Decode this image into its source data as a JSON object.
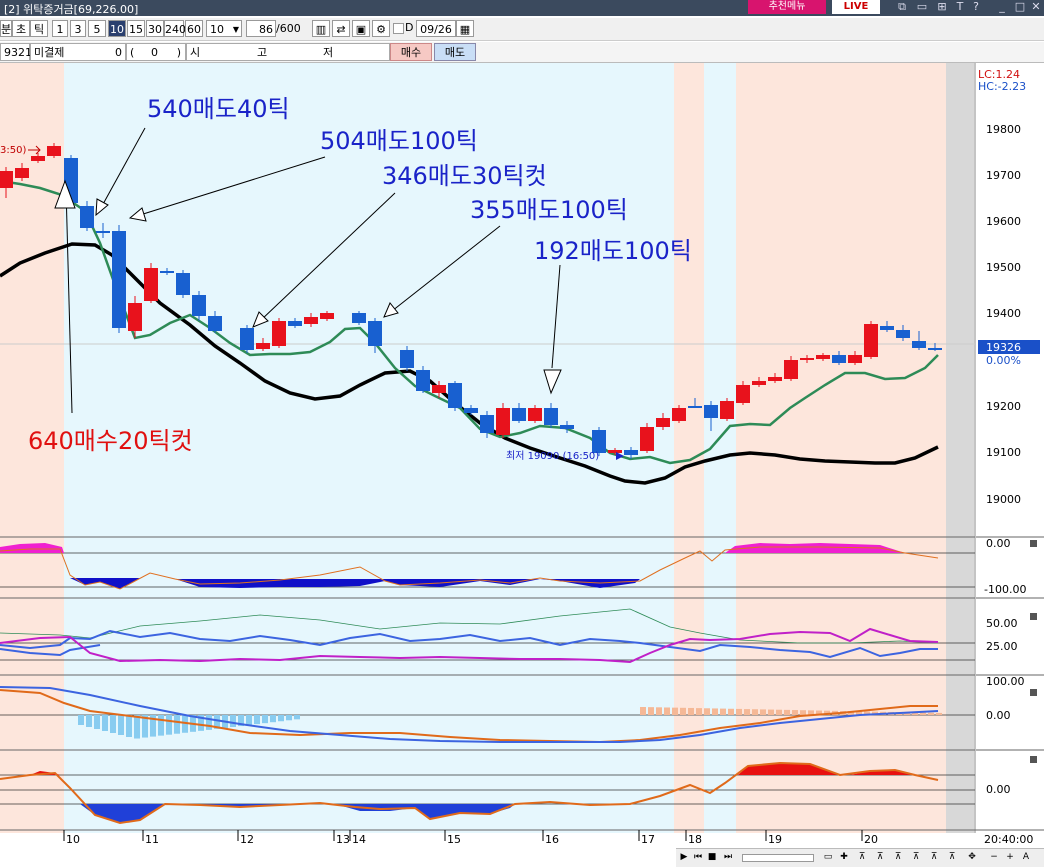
{
  "window": {
    "title": "[2] 위탁증거금[69,226.00]",
    "recommend_menu": "추천메뉴",
    "live": "LIVE"
  },
  "toolbar": {
    "buttons": [
      "분",
      "초",
      "틱",
      "1",
      "3",
      "5",
      "10",
      "15",
      "30",
      "240",
      "60"
    ],
    "selected": "10",
    "period_value": "10",
    "count_value": "86",
    "count_total": "/600",
    "date_value": "09/26",
    "d_label": "D"
  },
  "row2": {
    "code": "9321",
    "unsettled_label": "미결제",
    "unsettled_value": "0",
    "paren_left": "(",
    "paren_value": "0",
    "paren_right": ")",
    "open_label": "시",
    "high_label": "고",
    "low_label": "저",
    "buy_button": "매수",
    "sell_button": "매도"
  },
  "chart": {
    "lc_label": "LC:1.24",
    "hc_label": "HC:-2.23",
    "price_ticks": [
      "19800",
      "19700",
      "19600",
      "19500",
      "19400",
      "19300",
      "19200",
      "19100",
      "19000"
    ],
    "current_price": "19326",
    "current_change": "0.00%",
    "cut_label": "3:50)",
    "low_label": "최저 19090 (16:50)",
    "annotations": [
      {
        "text": "540매도40틱",
        "color": "#1a23c8"
      },
      {
        "text": "504매도100틱",
        "color": "#1a23c8"
      },
      {
        "text": "346매도30틱컷",
        "color": "#1a23c8"
      },
      {
        "text": "355매도100틱",
        "color": "#1a23c8"
      },
      {
        "text": "192매도100틱",
        "color": "#1a23c8"
      },
      {
        "text": "640매수20틱컷",
        "color": "#e01010"
      }
    ],
    "time_ticks": [
      "10",
      "11",
      "12",
      "13",
      "14",
      "15",
      "16",
      "17",
      "18",
      "19",
      "20"
    ],
    "time_current": "20:40:00",
    "ind1_ticks": [
      "0.00",
      "-100.00"
    ],
    "ind2_ticks": [
      "50.00",
      "25.00"
    ],
    "ind3_ticks": [
      "100.00",
      "0.00"
    ],
    "ind4_ticks": [
      "0.00"
    ],
    "colors": {
      "up": "#e8121c",
      "down": "#1860d0",
      "ma_short": "#2e8b57",
      "ma_long": "#000000",
      "bg_sell": "#e6f7fd",
      "bg_buy": "#fde6dc"
    }
  }
}
